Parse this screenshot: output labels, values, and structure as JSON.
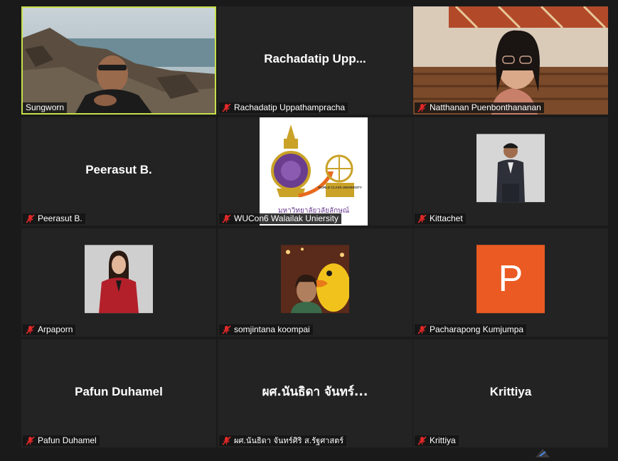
{
  "participants": [
    {
      "name": "Sungworn",
      "display": "",
      "muted": false,
      "active": true,
      "kind": "video-beach"
    },
    {
      "name": "Rachadatip Uppathampracha",
      "display": "Rachadatip Upp...",
      "muted": true,
      "kind": "name"
    },
    {
      "name": "Natthanan Puenbonthananan",
      "display": "",
      "muted": true,
      "kind": "video-woman"
    },
    {
      "name": "Peerasut B.",
      "display": "Peerasut B.",
      "muted": true,
      "kind": "name"
    },
    {
      "name": "WUCon6 Walailak Uniersity",
      "display": "",
      "muted": true,
      "kind": "logo"
    },
    {
      "name": "Kittachet",
      "display": "",
      "muted": true,
      "kind": "photo-man"
    },
    {
      "name": "Arpaporn",
      "display": "",
      "muted": true,
      "kind": "photo-woman-red"
    },
    {
      "name": "somjintana koompai",
      "display": "",
      "muted": true,
      "kind": "photo-duck"
    },
    {
      "name": "Pacharapong Kumjumpa",
      "display": "",
      "muted": true,
      "kind": "avatar",
      "initial": "P"
    },
    {
      "name": "Pafun Duhamel",
      "display": "Pafun Duhamel",
      "muted": true,
      "kind": "name"
    },
    {
      "name": "ผศ.นันธิดา จันทร์ศิริ ส.รัฐศาสตร์",
      "display": "ผศ.นันธิดา จันทร์...",
      "muted": true,
      "kind": "name"
    },
    {
      "name": "Krittiya",
      "display": "Krittiya",
      "muted": true,
      "kind": "name"
    }
  ],
  "logo": {
    "thai_text": "มหาวิทยาลัยวลัยลักษณ์",
    "badge_text": "WORLD CLASS UNIVERSITY"
  },
  "colors": {
    "active_border": "#c6e04a",
    "muted_icon": "#e02828",
    "avatar_bg": "#ea5a22"
  }
}
